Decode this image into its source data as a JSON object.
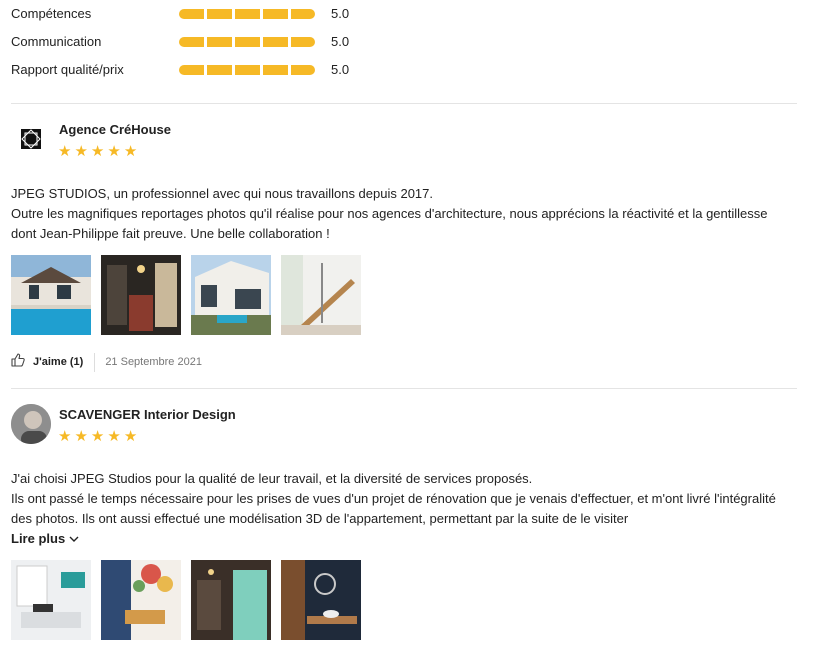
{
  "ratings": [
    {
      "label": "Compétences",
      "value": "5.0"
    },
    {
      "label": "Communication",
      "value": "5.0"
    },
    {
      "label": "Rapport qualité/prix",
      "value": "5.0"
    }
  ],
  "reviews": [
    {
      "author": "Agence CréHouse",
      "stars": 5,
      "paragraphs": [
        "JPEG STUDIOS, un professionnel avec qui nous travaillons depuis 2017.",
        "Outre les magnifiques reportages photos qu'il réalise pour nos agences d'architecture, nous apprécions la réactivité et la gentillesse dont Jean-Philippe fait preuve. Une belle collaboration !"
      ],
      "like_label": "J'aime (1)",
      "date": "21 Septembre 2021"
    },
    {
      "author": "SCAVENGER Interior Design",
      "stars": 5,
      "paragraphs": [
        "J'ai choisi JPEG Studios pour la qualité de leur travail, et la diversité de services proposés.",
        "Ils ont passé le temps nécessaire pour les prises de vues d'un projet de rénovation que je venais d'effectuer, et m'ont livré l'intégralité des photos. Ils ont aussi effectué une modélisation 3D de l'appartement, permettant par la suite de le visiter"
      ],
      "read_more": "Lire plus"
    }
  ],
  "colors": {
    "star": "#f6b926",
    "bar": "#f6b926"
  }
}
